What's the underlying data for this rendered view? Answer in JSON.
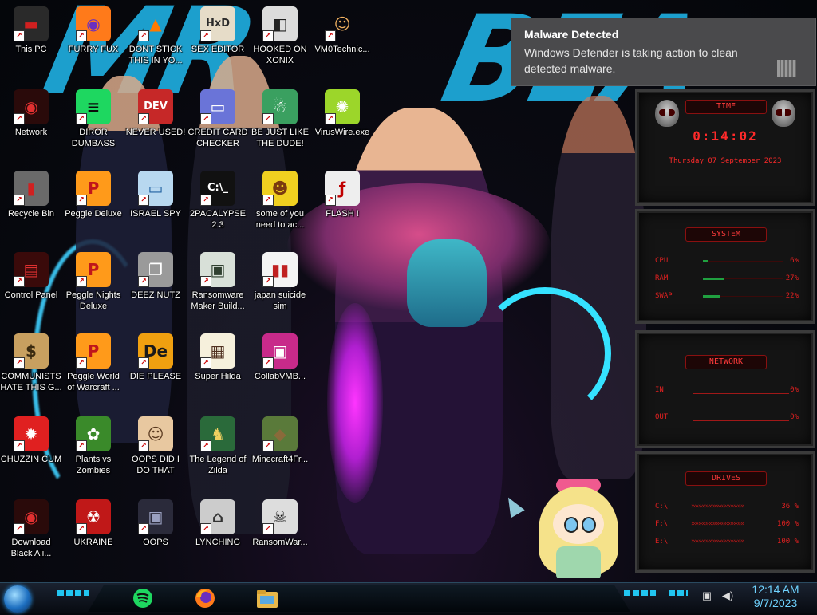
{
  "desktop": {
    "icons": [
      {
        "label": "This PC",
        "glyph": "▬",
        "bg": "#2a2a2a",
        "fg": "#d02020"
      },
      {
        "label": "FURRY FUX",
        "glyph": "◉",
        "bg": "#ff7a1a",
        "fg": "#6a2fc0"
      },
      {
        "label": "DONT STICK THIS IN YO...",
        "glyph": "▲",
        "bg": "transparent",
        "fg": "#ff7a00"
      },
      {
        "label": "SEX EDITOR",
        "glyph": "HxD",
        "bg": "#e6dcc8",
        "fg": "#2a2a2a"
      },
      {
        "label": "HOOKED ON XONIX",
        "glyph": "◧",
        "bg": "#dcdcdc",
        "fg": "#222222"
      },
      {
        "label": "VM0Technic...",
        "glyph": "☺",
        "bg": "transparent",
        "fg": "#f0b060"
      },
      {
        "label": "Network",
        "glyph": "◉",
        "bg": "#2a0a0a",
        "fg": "#e03030"
      },
      {
        "label": "DIROR DUMBASS",
        "glyph": "≡",
        "bg": "#1ed760",
        "fg": "#0b0b0b"
      },
      {
        "label": "NEVER USED!",
        "glyph": "DEV",
        "bg": "#c62828",
        "fg": "#ffffff"
      },
      {
        "label": "CREDIT CARD CHECKER",
        "glyph": "▭",
        "bg": "#6a74d8",
        "fg": "#ffffff"
      },
      {
        "label": "BE JUST LIKE THE DUDE!",
        "glyph": "☃",
        "bg": "#3aa060",
        "fg": "#ffffff"
      },
      {
        "label": "VirusWire.exe",
        "glyph": "✺",
        "bg": "#9cd62a",
        "fg": "#ffffff"
      },
      {
        "label": "Recycle Bin",
        "glyph": "▮",
        "bg": "#6a6a6a",
        "fg": "#d02020"
      },
      {
        "label": "Peggle Deluxe",
        "glyph": "P",
        "bg": "#ff9a1a",
        "fg": "#c0151b"
      },
      {
        "label": "ISRAEL SPY",
        "glyph": "▭",
        "bg": "#b8d8f0",
        "fg": "#2060a0"
      },
      {
        "label": "2PACALYPSE 2.3",
        "glyph": "C:\\_",
        "bg": "#111111",
        "fg": "#ffffff"
      },
      {
        "label": "some of you need to ac...",
        "glyph": "☻",
        "bg": "#f0d020",
        "fg": "#7a3a10"
      },
      {
        "label": "FLASH !",
        "glyph": "ƒ",
        "bg": "#eeeeee",
        "fg": "#c00000"
      },
      {
        "label": "Control Panel",
        "glyph": "▤",
        "bg": "#3a0a0a",
        "fg": "#e03030"
      },
      {
        "label": "Peggle Nights Deluxe",
        "glyph": "P",
        "bg": "#ff9a1a",
        "fg": "#c0151b"
      },
      {
        "label": "DEEZ NUTZ",
        "glyph": "❐",
        "bg": "#9a9a9a",
        "fg": "#ffffff"
      },
      {
        "label": "Ransomware Maker Build...",
        "glyph": "▣",
        "bg": "#d8e0d8",
        "fg": "#304030"
      },
      {
        "label": "japan suicide sim",
        "glyph": "▮▮",
        "bg": "#f4f4f4",
        "fg": "#c02020"
      },
      {
        "label": "COMMUNISTS HATE THIS G...",
        "glyph": "$",
        "bg": "#c8a060",
        "fg": "#3a2a10"
      },
      {
        "label": "Peggle World of Warcraft ...",
        "glyph": "P",
        "bg": "#ff9a1a",
        "fg": "#c0151b"
      },
      {
        "label": "DIE PLEASE",
        "glyph": "De",
        "bg": "#f0a010",
        "fg": "#1a1a1a"
      },
      {
        "label": "Super Hilda",
        "glyph": "▦",
        "bg": "#f6f0dc",
        "fg": "#503020"
      },
      {
        "label": "CollabVMB...",
        "glyph": "▣",
        "bg": "#c82a8a",
        "fg": "#ffffff"
      },
      {
        "label": "CHUZZIN CUM",
        "glyph": "✹",
        "bg": "#e02020",
        "fg": "#ffffff"
      },
      {
        "label": "Plants vs Zombies",
        "glyph": "✿",
        "bg": "#3a8a2a",
        "fg": "#ffffff"
      },
      {
        "label": "OOPS DID I DO THAT",
        "glyph": "☺",
        "bg": "#e8c8a0",
        "fg": "#5a3a20"
      },
      {
        "label": "The Legend of Zilda",
        "glyph": "♞",
        "bg": "#2a6a3a",
        "fg": "#f0d060"
      },
      {
        "label": "Minecraft4Fr...",
        "glyph": "◆",
        "bg": "#5a7a3a",
        "fg": "#8a6a3a"
      },
      {
        "label": "Download Black Ali...",
        "glyph": "◉",
        "bg": "#2a0a0a",
        "fg": "#e03030"
      },
      {
        "label": "UKRAINE",
        "glyph": "☢",
        "bg": "#c01818",
        "fg": "#ffffff"
      },
      {
        "label": "OOPS",
        "glyph": "▣",
        "bg": "#2a2a3a",
        "fg": "#9aa0c0"
      },
      {
        "label": "LYNCHING",
        "glyph": "⌂",
        "bg": "#cccccc",
        "fg": "#333333"
      },
      {
        "label": "RansomWar...",
        "glyph": "☠",
        "bg": "#dddddd",
        "fg": "#111111"
      }
    ]
  },
  "notification": {
    "title": "Malware Detected",
    "message": "Windows Defender is taking action to clean detected malware."
  },
  "widgets": {
    "clock": {
      "title": "TIME",
      "time": "0:14:02",
      "date": "Thursday 07 September 2023"
    },
    "system": {
      "title": "SYSTEM",
      "rows": [
        {
          "key": "CPU",
          "value": "6%"
        },
        {
          "key": "RAM",
          "value": "27%"
        },
        {
          "key": "SWAP",
          "value": "22%"
        }
      ]
    },
    "network": {
      "title": "NETWORK",
      "rows": [
        {
          "key": "IN",
          "value": "0%"
        },
        {
          "key": "OUT",
          "value": "0%"
        }
      ]
    },
    "drives": {
      "title": "DRIVES",
      "rows": [
        {
          "key": "C:\\",
          "value": "36 %"
        },
        {
          "key": "F:\\",
          "value": "100 %"
        },
        {
          "key": "E:\\",
          "value": "100 %"
        }
      ]
    }
  },
  "taskbar": {
    "clock_time": "12:14 AM",
    "clock_date": "9/7/2023"
  },
  "colors": {
    "accent": "#21c5f0",
    "widget_red": "#e02020",
    "toast_bg": "#4a4a4c"
  }
}
